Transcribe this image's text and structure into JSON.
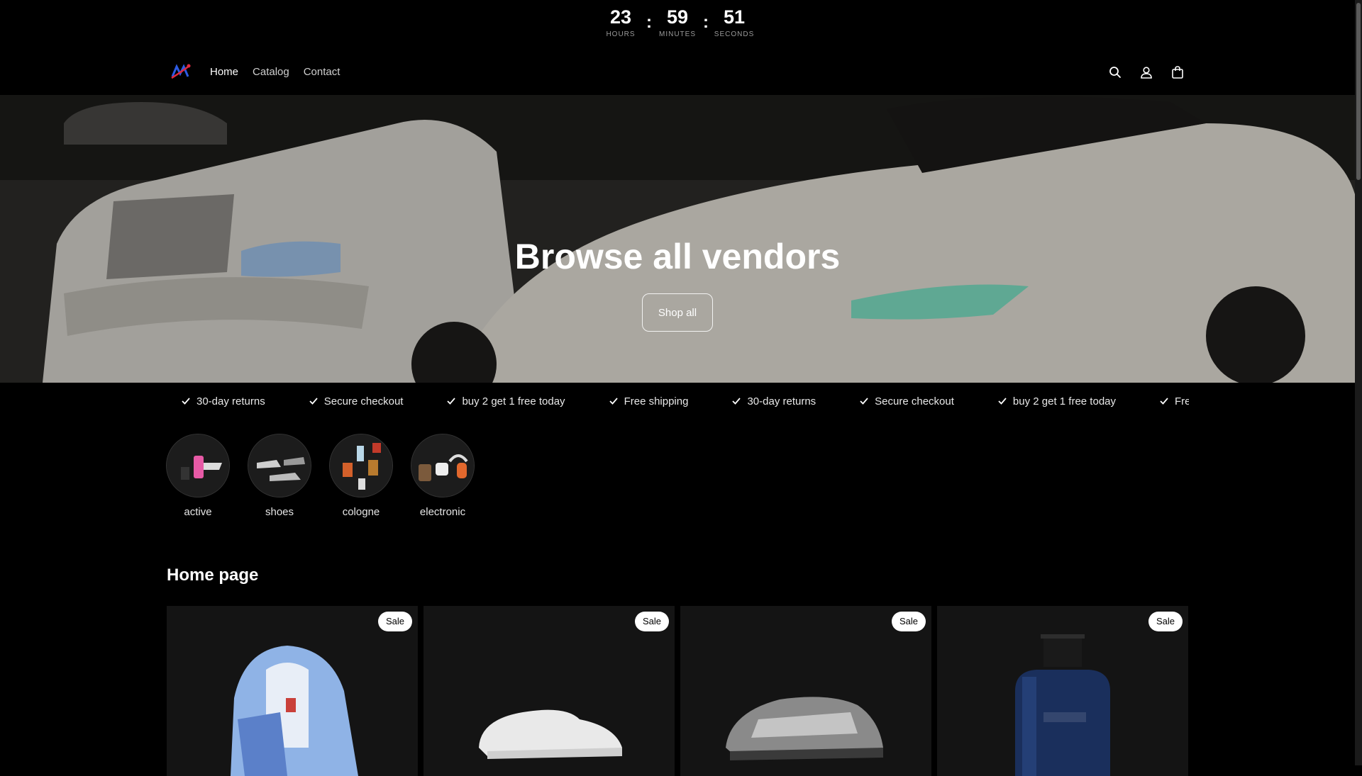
{
  "countdown": {
    "hours": "23",
    "hours_label": "HOURS",
    "minutes": "59",
    "minutes_label": "MINUTES",
    "seconds": "51",
    "seconds_label": "SECONDS",
    "separator": ":"
  },
  "header": {
    "nav": [
      {
        "label": "Home",
        "active": true
      },
      {
        "label": "Catalog",
        "active": false
      },
      {
        "label": "Contact",
        "active": false
      }
    ],
    "icons": [
      "search-icon",
      "account-icon",
      "cart-icon"
    ]
  },
  "hero": {
    "title": "Browse all vendors",
    "button_label": "Shop all"
  },
  "marquee": {
    "items": [
      "30-day returns",
      "Secure checkout",
      "buy 2 get 1 free today",
      "Free shipping",
      "30-day returns",
      "Secure checkout",
      "buy 2 get 1 free today",
      "Free shipping"
    ]
  },
  "categories": [
    {
      "label": "active"
    },
    {
      "label": "shoes"
    },
    {
      "label": "cologne"
    },
    {
      "label": "electronic"
    }
  ],
  "section": {
    "title": "Home page",
    "products": [
      {
        "badge": "Sale",
        "kind": "tracksuit"
      },
      {
        "badge": "Sale",
        "kind": "white-sneaker"
      },
      {
        "badge": "Sale",
        "kind": "silver-sneaker"
      },
      {
        "badge": "Sale",
        "kind": "cologne-bottle"
      }
    ]
  },
  "colors": {
    "background": "#000000",
    "card": "#141414",
    "badge_bg": "#ffffff"
  }
}
